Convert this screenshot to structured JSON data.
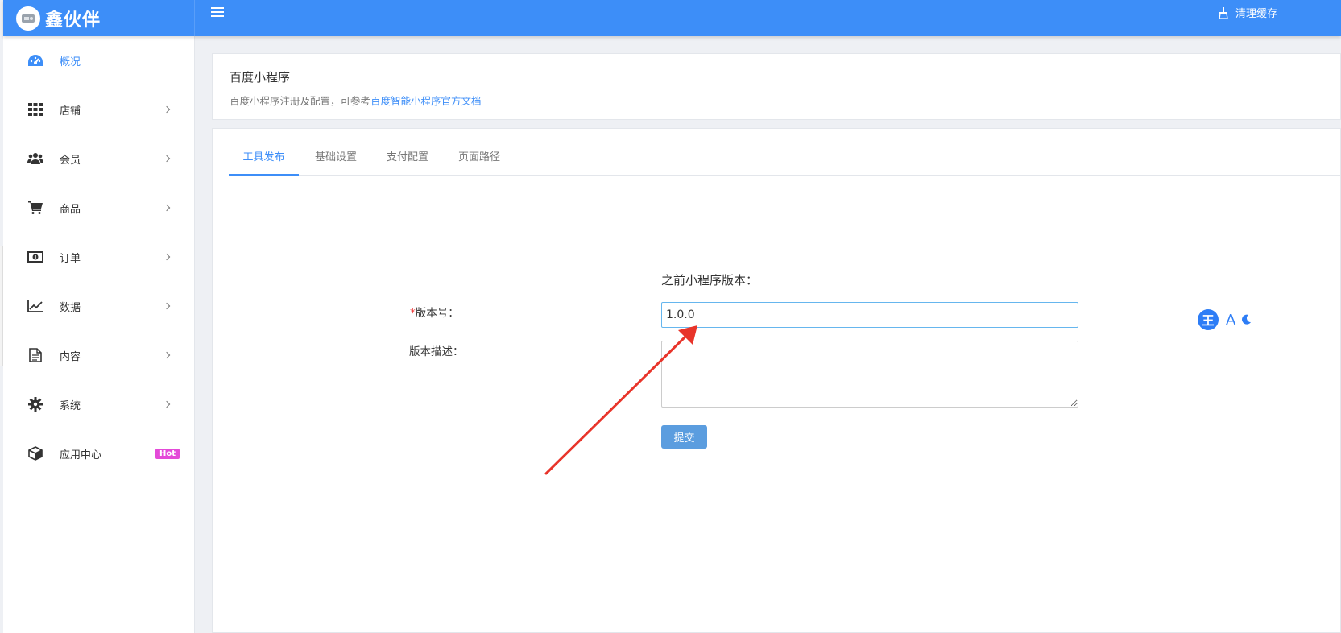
{
  "header": {
    "brand": "鑫伙伴",
    "clean_cache": "清理缓存"
  },
  "sidebar": {
    "items": [
      {
        "label": "概况",
        "icon": "dashboard-icon",
        "active": true
      },
      {
        "label": "店铺",
        "icon": "grid-icon"
      },
      {
        "label": "会员",
        "icon": "users-icon"
      },
      {
        "label": "商品",
        "icon": "cart-icon"
      },
      {
        "label": "订单",
        "icon": "money-icon"
      },
      {
        "label": "数据",
        "icon": "chart-icon"
      },
      {
        "label": "内容",
        "icon": "document-icon"
      },
      {
        "label": "系统",
        "icon": "gear-icon"
      },
      {
        "label": "应用中心",
        "icon": "cube-icon",
        "badge": "Hot"
      }
    ]
  },
  "page": {
    "title": "百度小程序",
    "description": "百度小程序注册及配置，可参考",
    "doc_link": "百度智能小程序官方文档"
  },
  "tabs": [
    {
      "label": "工具发布",
      "active": true
    },
    {
      "label": "基础设置"
    },
    {
      "label": "支付配置"
    },
    {
      "label": "页面路径"
    }
  ],
  "form": {
    "previous_version_label": "之前小程序版本：",
    "required_mark": "*",
    "version_label": "版本号：",
    "version_value": "1.0.0",
    "description_label": "版本描述：",
    "description_value": "",
    "submit_label": "提交"
  },
  "float_toolbar": {
    "logo_text": "王",
    "font_text": "A"
  },
  "colors": {
    "primary": "#3d8ef8",
    "annotation_arrow": "#e8342a",
    "hot_badge": "#e44ad8"
  }
}
